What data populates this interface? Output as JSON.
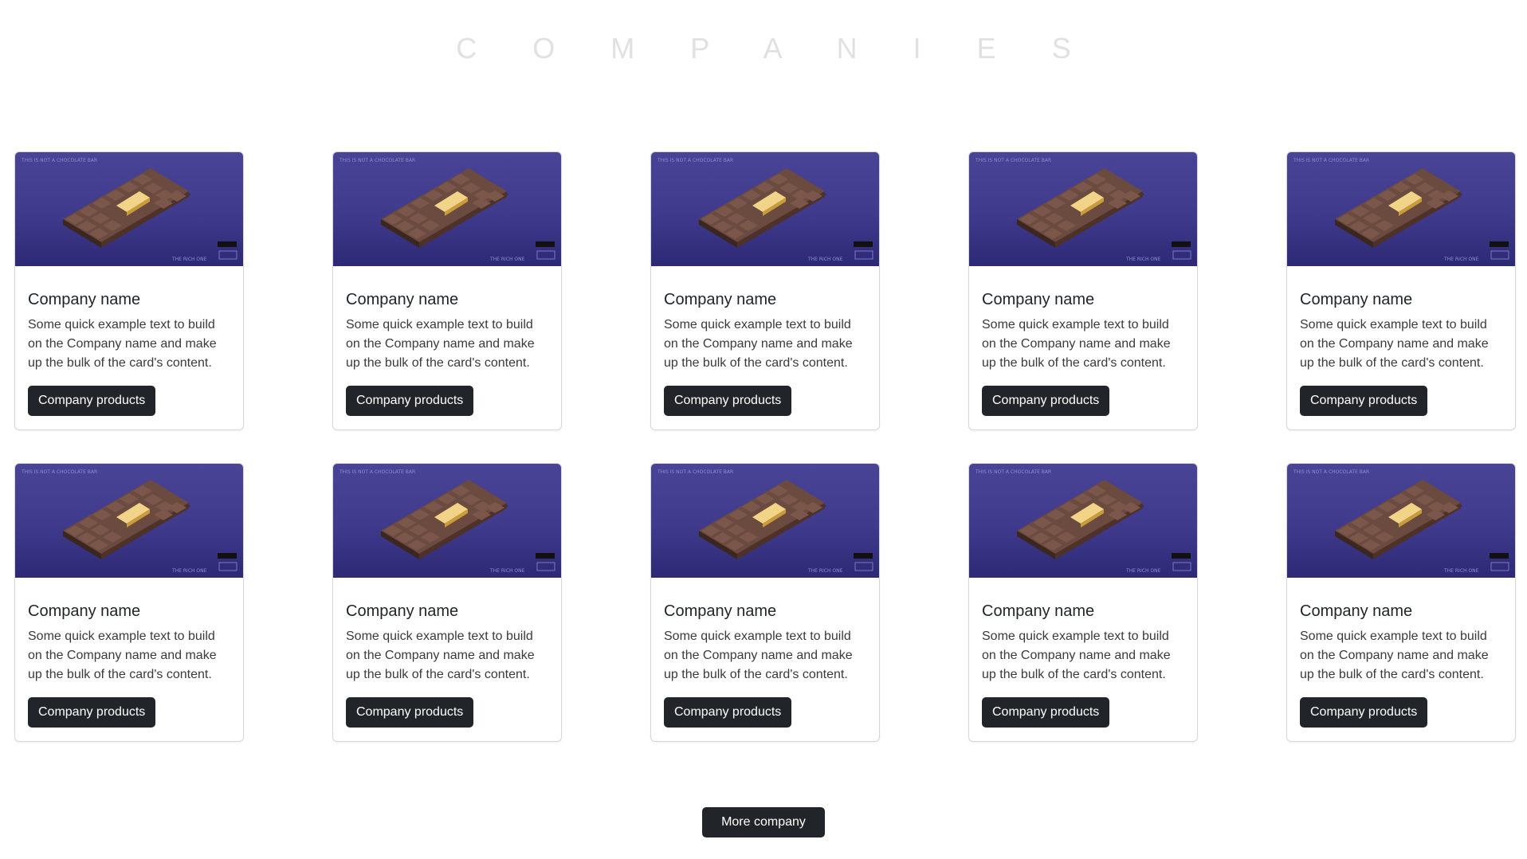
{
  "page": {
    "title": "C O M P A N I E S"
  },
  "cards": [
    {
      "image_top_text": "THIS IS NOT A CHOCOLATE BAR",
      "image_bottom_text": "THE RICH ONE",
      "title": "Company name",
      "text": "Some quick example text to build on the Company name and make up the bulk of the card's content.",
      "button": "Company products"
    },
    {
      "image_top_text": "THIS IS NOT A CHOCOLATE BAR",
      "image_bottom_text": "THE RICH ONE",
      "title": "Company name",
      "text": "Some quick example text to build on the Company name and make up the bulk of the card's content.",
      "button": "Company products"
    },
    {
      "image_top_text": "THIS IS NOT A CHOCOLATE BAR",
      "image_bottom_text": "THE RICH ONE",
      "title": "Company name",
      "text": "Some quick example text to build on the Company name and make up the bulk of the card's content.",
      "button": "Company products"
    },
    {
      "image_top_text": "THIS IS NOT A CHOCOLATE BAR",
      "image_bottom_text": "THE RICH ONE",
      "title": "Company name",
      "text": "Some quick example text to build on the Company name and make up the bulk of the card's content.",
      "button": "Company products"
    },
    {
      "image_top_text": "THIS IS NOT A CHOCOLATE BAR",
      "image_bottom_text": "THE RICH ONE",
      "title": "Company name",
      "text": "Some quick example text to build on the Company name and make up the bulk of the card's content.",
      "button": "Company products"
    },
    {
      "image_top_text": "THIS IS NOT A CHOCOLATE BAR",
      "image_bottom_text": "THE RICH ONE",
      "title": "Company name",
      "text": "Some quick example text to build on the Company name and make up the bulk of the card's content.",
      "button": "Company products"
    },
    {
      "image_top_text": "THIS IS NOT A CHOCOLATE BAR",
      "image_bottom_text": "THE RICH ONE",
      "title": "Company name",
      "text": "Some quick example text to build on the Company name and make up the bulk of the card's content.",
      "button": "Company products"
    },
    {
      "image_top_text": "THIS IS NOT A CHOCOLATE BAR",
      "image_bottom_text": "THE RICH ONE",
      "title": "Company name",
      "text": "Some quick example text to build on the Company name and make up the bulk of the card's content.",
      "button": "Company products"
    },
    {
      "image_top_text": "THIS IS NOT A CHOCOLATE BAR",
      "image_bottom_text": "THE RICH ONE",
      "title": "Company name",
      "text": "Some quick example text to build on the Company name and make up the bulk of the card's content.",
      "button": "Company products"
    },
    {
      "image_top_text": "THIS IS NOT A CHOCOLATE BAR",
      "image_bottom_text": "THE RICH ONE",
      "title": "Company name",
      "text": "Some quick example text to build on the Company name and make up the bulk of the card's content.",
      "button": "Company products"
    }
  ],
  "footer": {
    "more_button": "More company"
  },
  "colors": {
    "title": "#e1e1e1",
    "button_bg": "#212529",
    "image_bg": "#3f3a8c"
  }
}
